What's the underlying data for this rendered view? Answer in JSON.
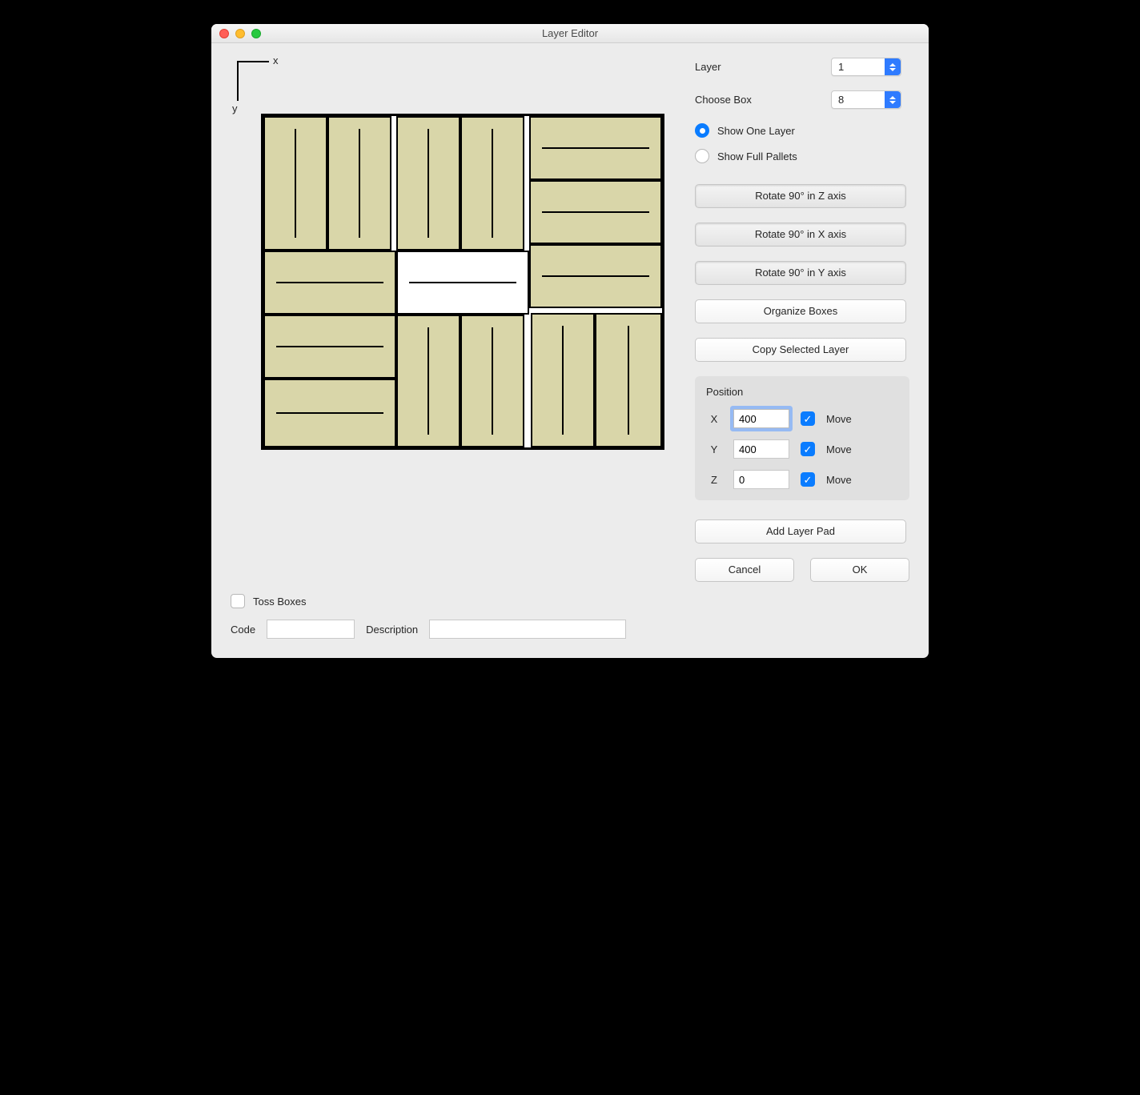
{
  "window": {
    "title": "Layer Editor"
  },
  "axes": {
    "x": "x",
    "y": "y"
  },
  "left": {
    "toss_label": "Toss Boxes",
    "toss_checked": false,
    "code_label": "Code",
    "code_value": "",
    "desc_label": "Description",
    "desc_value": ""
  },
  "right": {
    "layer_label": "Layer",
    "layer_value": "1",
    "choose_label": "Choose Box",
    "choose_value": "8",
    "radio1": "Show One Layer",
    "radio2": "Show Full Pallets",
    "radio_selected": 1,
    "btn_rot_z": "Rotate 90° in Z axis",
    "btn_rot_x": "Rotate 90° in X axis",
    "btn_rot_y": "Rotate 90° in Y axis",
    "btn_org": "Organize Boxes",
    "btn_copy": "Copy Selected Layer",
    "pos_title": "Position",
    "pos": {
      "x_label": "X",
      "x_value": "400",
      "x_move": true,
      "y_label": "Y",
      "y_value": "400",
      "y_move": true,
      "z_label": "Z",
      "z_value": "0",
      "z_move": true,
      "move_label": "Move"
    },
    "btn_pad": "Add Layer Pad",
    "btn_cancel": "Cancel",
    "btn_ok": "OK"
  }
}
